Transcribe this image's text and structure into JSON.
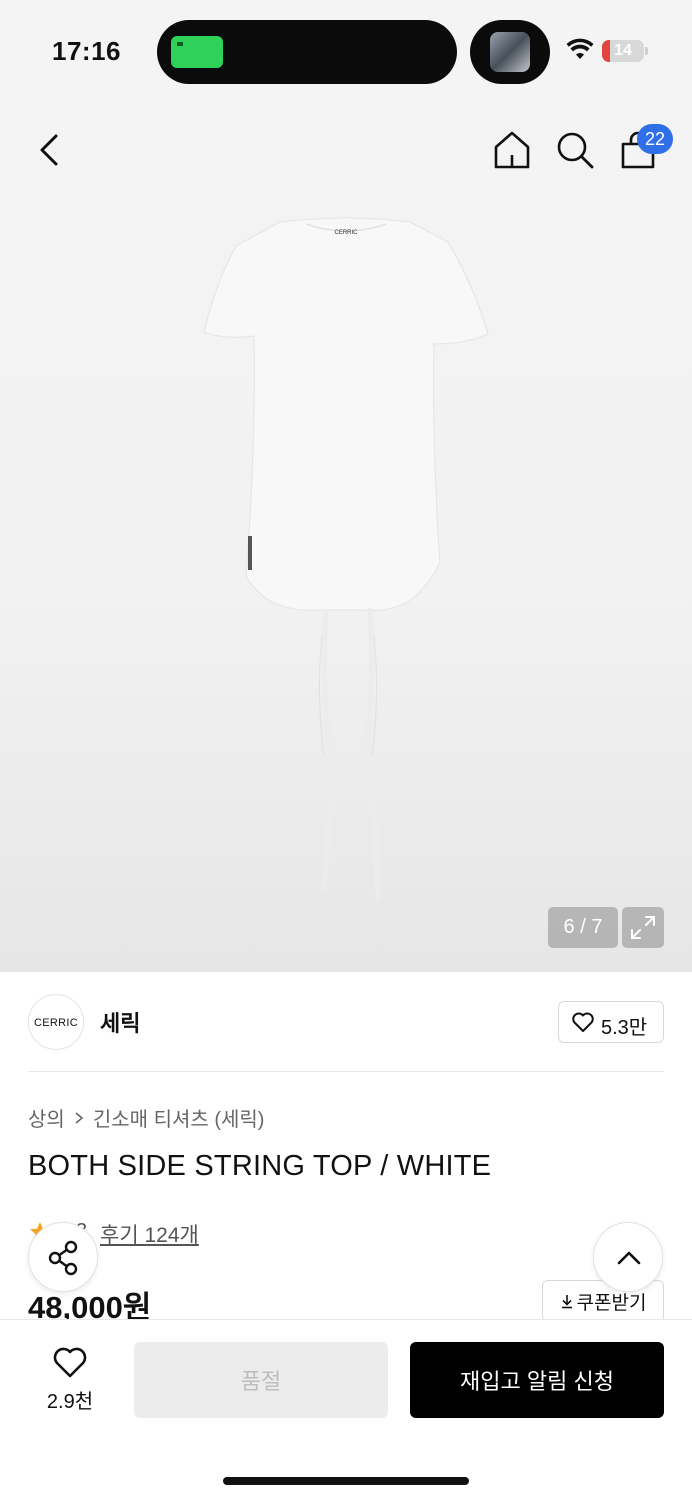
{
  "status_bar": {
    "time": "17:16",
    "battery_level": "14",
    "battery_color": "#e0463d"
  },
  "nav": {
    "cart_count": "22",
    "icons": [
      "back-arrow-icon",
      "home-icon",
      "search-icon",
      "shopping-bag-icon"
    ]
  },
  "gallery": {
    "counter": "6 / 7",
    "current": 6,
    "total": 7,
    "product_label": "CERRIC"
  },
  "brand": {
    "logo_text": "CERRIC",
    "name": "세릭",
    "likes": "5.3만"
  },
  "breadcrumb": {
    "category": "상의",
    "subcategory": "긴소매 티셔츠 (세릭)"
  },
  "product": {
    "title": "BOTH SIDE STRING TOP / WHITE",
    "rating_partial": "3",
    "review_link": "후기 124개",
    "price": "48,000원",
    "coupon_label": "쿠폰받기"
  },
  "bottom_bar": {
    "wish_count": "2.9천",
    "soldout_label": "품절",
    "restock_label": "재입고 알림 신청"
  },
  "colors": {
    "accent_blue": "#2f6fe8",
    "star_orange": "#f5a623",
    "primary_black": "#000000"
  }
}
